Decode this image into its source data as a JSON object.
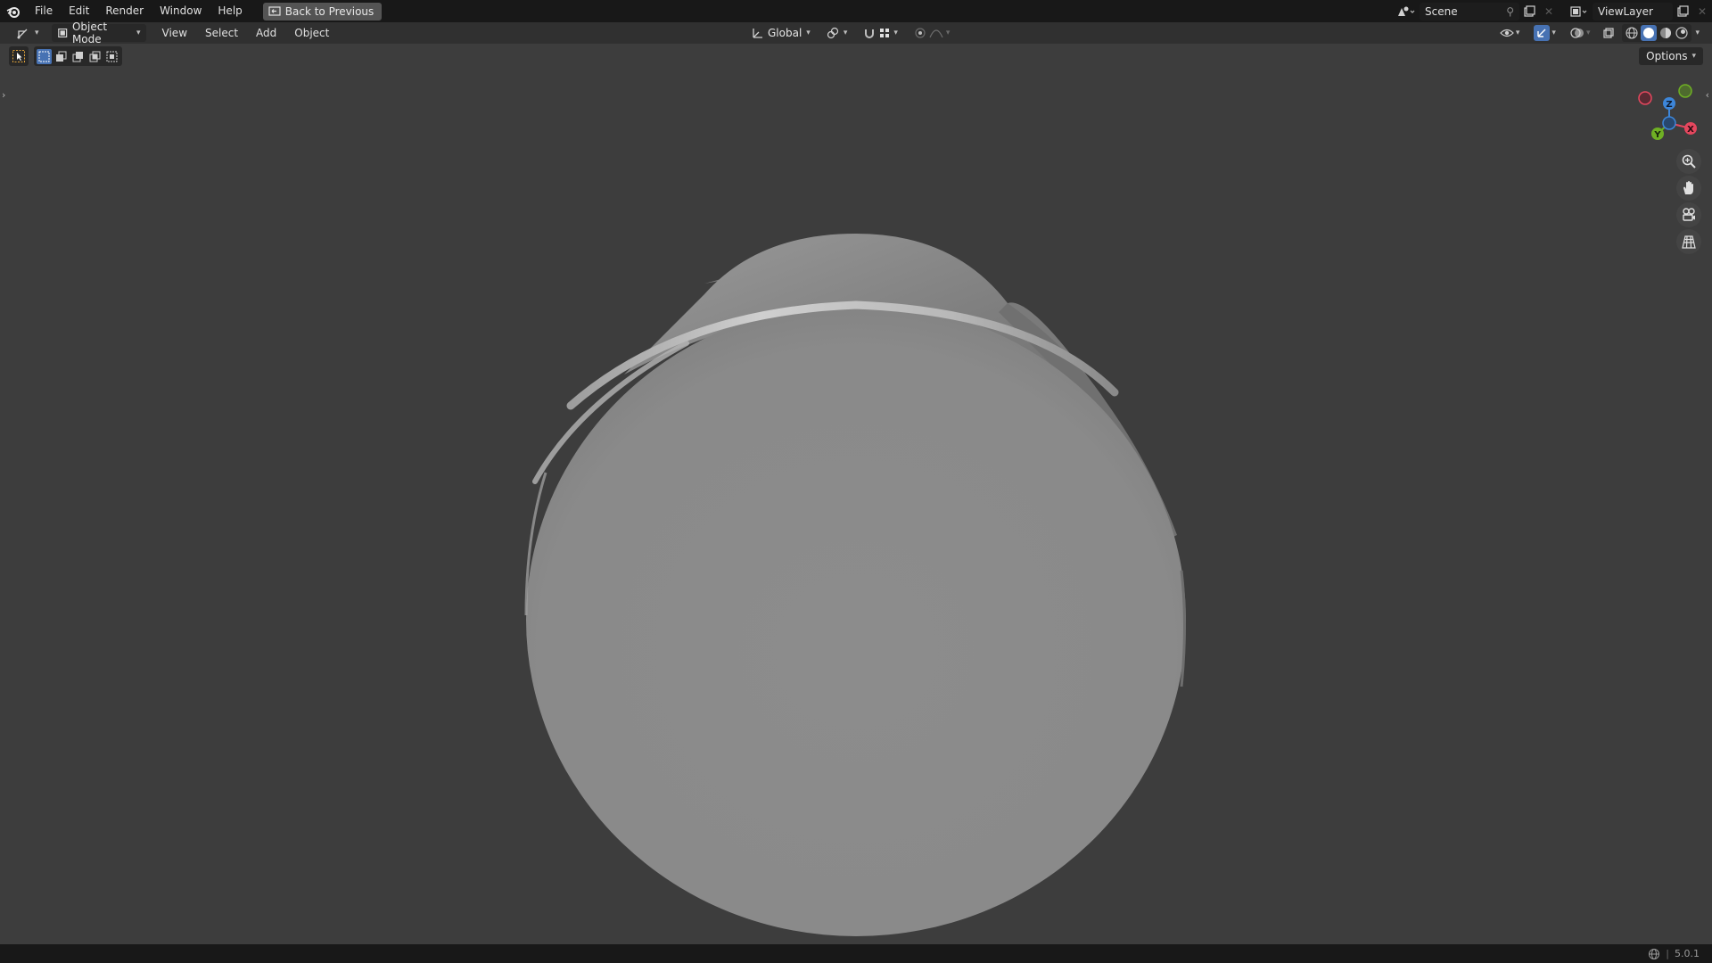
{
  "topbar": {
    "menus": [
      "File",
      "Edit",
      "Render",
      "Window",
      "Help"
    ],
    "back_button": "Back to Previous",
    "scene": "Scene",
    "view_layer": "ViewLayer"
  },
  "header": {
    "mode": "Object Mode",
    "menus": [
      "View",
      "Select",
      "Add",
      "Object"
    ],
    "transform_orientation": "Global"
  },
  "options_label": "Options",
  "gizmo": {
    "x_label": "X",
    "y_label": "Y",
    "z_label": "Z"
  },
  "status": {
    "version": "5.0.1"
  },
  "colors": {
    "x_axis": "#e5475e",
    "y_axis": "#6fb024",
    "z_axis": "#3d86d9",
    "accent": "#4772b3"
  }
}
